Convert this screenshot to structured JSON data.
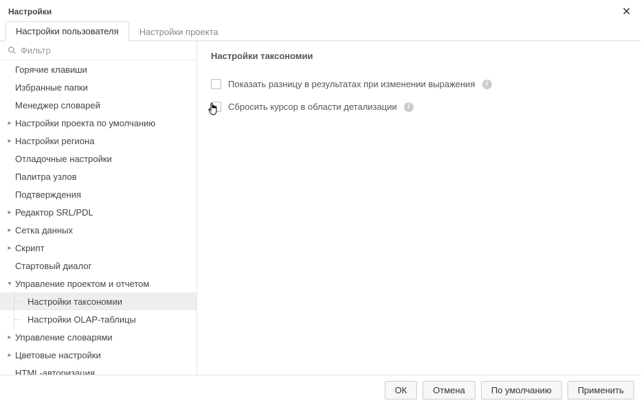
{
  "window": {
    "title": "Настройки"
  },
  "tabs": {
    "user": "Настройки пользователя",
    "project": "Настройки проекта"
  },
  "filter": {
    "placeholder": "Фильтр"
  },
  "tree": {
    "hotkeys": "Горячие клавиши",
    "favfolders": "Избранные папки",
    "dictmgr": "Менеджер словарей",
    "defproject": "Настройки проекта по умолчанию",
    "region": "Настройки региона",
    "debug": "Отладочные настройки",
    "nodepalette": "Палитра узлов",
    "confirmations": "Подтверждения",
    "srlpdl": "Редактор SRL/PDL",
    "datagrid": "Сетка данных",
    "script": "Скрипт",
    "startdialog": "Стартовый диалог",
    "projectreport": "Управление проектом и отчетом",
    "taxonomy": "Настройки таксономии",
    "olap": "Настройки OLAP-таблицы",
    "dictmgmt": "Управление словарями",
    "colors": "Цветовые настройки",
    "htmlauth": "HTML-авторизация"
  },
  "content": {
    "title": "Настройки таксономии",
    "opt1": "Показать разницу в результатах при изменении выражения",
    "opt2": "Сбросить курсор в области детализации"
  },
  "buttons": {
    "ok": "ОК",
    "cancel": "Отмена",
    "defaults": "По умолчанию",
    "apply": "Применить"
  }
}
